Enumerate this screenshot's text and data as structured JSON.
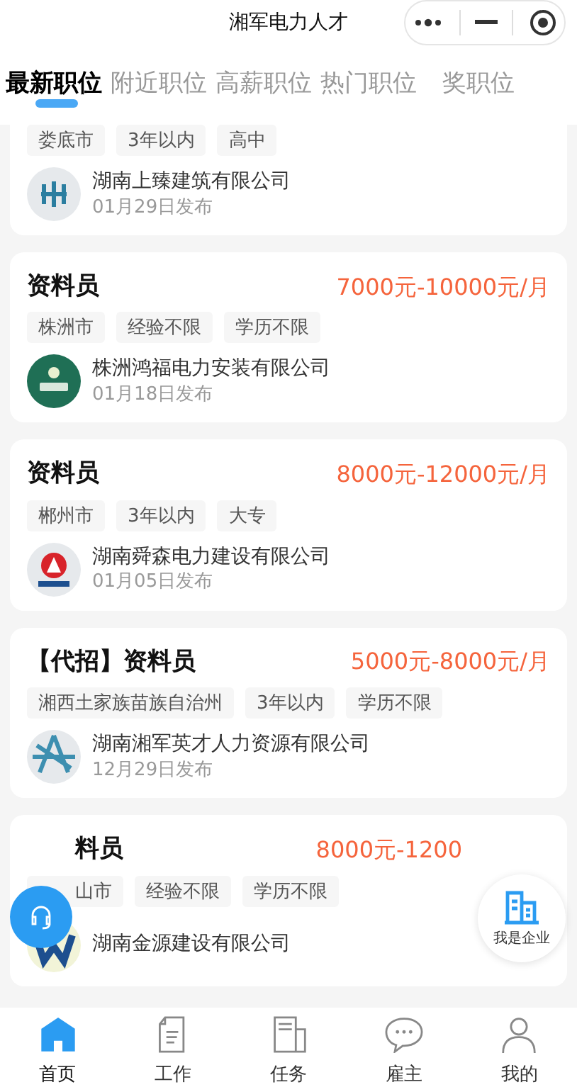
{
  "window": {
    "title": "湘军电力人才"
  },
  "tabs": [
    {
      "label": "最新职位",
      "selected": true
    },
    {
      "label": "附近职位",
      "selected": false
    },
    {
      "label": "高薪职位",
      "selected": false
    },
    {
      "label": "热门职位",
      "selected": false
    },
    {
      "label": "奖职位",
      "selected": false
    }
  ],
  "jobs": [
    {
      "tags": [
        "娄底市",
        "3年以内",
        "高中"
      ],
      "company": "湖南上臻建筑有限公司",
      "date": "01月29日发布"
    },
    {
      "title": "资料员",
      "salary": "7000元-10000元/月",
      "tags": [
        "株洲市",
        "经验不限",
        "学历不限"
      ],
      "company": "株洲鸿福电力安装有限公司",
      "date": "01月18日发布"
    },
    {
      "title": "资料员",
      "salary": "8000元-12000元/月",
      "tags": [
        "郴州市",
        "3年以内",
        "大专"
      ],
      "company": "湖南舜森电力建设有限公司",
      "date": "01月05日发布"
    },
    {
      "title": "【代招】资料员",
      "salary": "5000元-8000元/月",
      "tags": [
        "湘西土家族苗族自治州",
        "3年以内",
        "学历不限"
      ],
      "company": "湖南湘军英才人力资源有限公司",
      "date": "12月29日发布"
    },
    {
      "title": "料员",
      "salary": "8000元-1200",
      "tags": [
        "山市",
        "经验不限",
        "学历不限"
      ],
      "company": "湖南金源建设有限公司"
    }
  ],
  "enterprise_button": {
    "label": "我是企业"
  },
  "bottom_nav": [
    {
      "label": "首页",
      "selected": true
    },
    {
      "label": "工作",
      "selected": false
    },
    {
      "label": "任务",
      "selected": false
    },
    {
      "label": "雇主",
      "selected": false
    },
    {
      "label": "我的",
      "selected": false
    }
  ]
}
